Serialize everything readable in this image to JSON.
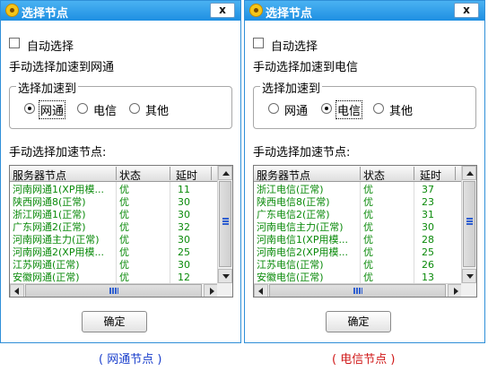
{
  "dialogs": [
    {
      "title": "选择节点",
      "close_label": "x",
      "auto_select_label": "自动选择",
      "manual_accel_text": "手动选择加速到网通",
      "group_title": "选择加速到",
      "radios": [
        {
          "label": "网通",
          "checked": true
        },
        {
          "label": "电信",
          "checked": false
        },
        {
          "label": "其他",
          "checked": false
        }
      ],
      "nodes_label": "手动选择加速节点:",
      "columns": [
        "服务器节点",
        "状态",
        "延时"
      ],
      "rows": [
        {
          "name": "河南网通1(XP用模...",
          "status": "优",
          "delay": "11"
        },
        {
          "name": "陕西网通8(正常)",
          "status": "优",
          "delay": "30"
        },
        {
          "name": "浙江网通1(正常)",
          "status": "优",
          "delay": "30"
        },
        {
          "name": "广东网通2(正常)",
          "status": "优",
          "delay": "32"
        },
        {
          "name": "河南网通主力(正常)",
          "status": "优",
          "delay": "30"
        },
        {
          "name": "河南网通2(XP用模...",
          "status": "优",
          "delay": "25"
        },
        {
          "name": "江苏网通(正常)",
          "status": "优",
          "delay": "30"
        },
        {
          "name": "安徽网通(正常)",
          "status": "优",
          "delay": "12"
        }
      ],
      "ok_label": "确定"
    },
    {
      "title": "选择节点",
      "close_label": "x",
      "auto_select_label": "自动选择",
      "manual_accel_text": "手动选择加速到电信",
      "group_title": "选择加速到",
      "radios": [
        {
          "label": "网通",
          "checked": false
        },
        {
          "label": "电信",
          "checked": true
        },
        {
          "label": "其他",
          "checked": false
        }
      ],
      "nodes_label": "手动选择加速节点:",
      "columns": [
        "服务器节点",
        "状态",
        "延时"
      ],
      "rows": [
        {
          "name": "浙江电信(正常)",
          "status": "优",
          "delay": "37"
        },
        {
          "name": "陕西电信8(正常)",
          "status": "优",
          "delay": "23"
        },
        {
          "name": "广东电信2(正常)",
          "status": "优",
          "delay": "31"
        },
        {
          "name": "河南电信主力(正常)",
          "status": "优",
          "delay": "30"
        },
        {
          "name": "河南电信1(XP用模...",
          "status": "优",
          "delay": "28"
        },
        {
          "name": "河南电信2(XP用模...",
          "status": "优",
          "delay": "25"
        },
        {
          "name": "江苏电信(正常)",
          "status": "优",
          "delay": "26"
        },
        {
          "name": "安徽电信(正常)",
          "status": "优",
          "delay": "13"
        }
      ],
      "ok_label": "确定"
    }
  ],
  "captions": [
    "( 网通节点 )",
    "( 电信节点 )"
  ],
  "colors": {
    "caption_left": "#1a3fcc",
    "caption_right": "#d01818",
    "row_text": "#0a8a0a",
    "titlebar": "#1e8fe2"
  }
}
